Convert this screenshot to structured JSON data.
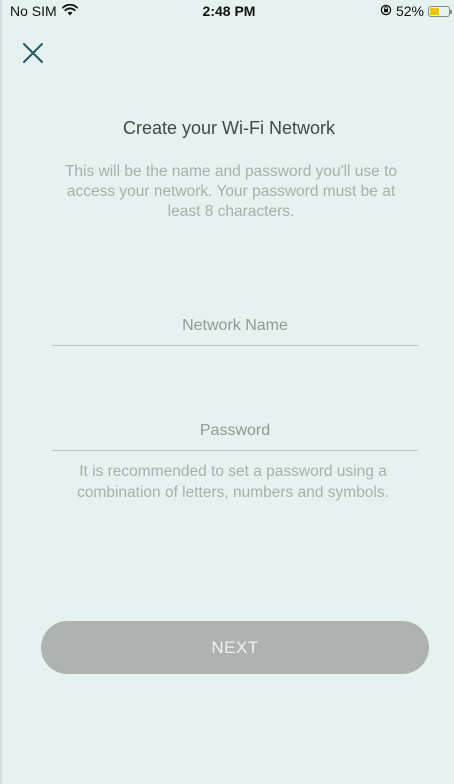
{
  "status_bar": {
    "carrier": "No SIM",
    "time": "2:48 PM",
    "battery_percent": "52%",
    "battery_level": 0.52,
    "wifi_icon": "wifi-icon",
    "rotation_lock_icon": "rotation-lock-icon"
  },
  "header": {
    "close_icon": "close-icon"
  },
  "content": {
    "title": "Create your Wi-Fi Network",
    "description": "This will be the name and password you'll use to access your network. Your password must be at least 8 characters.",
    "network_name": {
      "value": "",
      "placeholder": "Network Name"
    },
    "password": {
      "value": "",
      "placeholder": "Password"
    },
    "hint": "It is recommended to set a password using a combination of letters, numbers and symbols."
  },
  "actions": {
    "next_label": "NEXT"
  },
  "colors": {
    "background": "#e6f2ef",
    "button_disabled": "#aeb3b2",
    "close_icon": "#1f5f63",
    "battery_fill": "#f2c200"
  }
}
